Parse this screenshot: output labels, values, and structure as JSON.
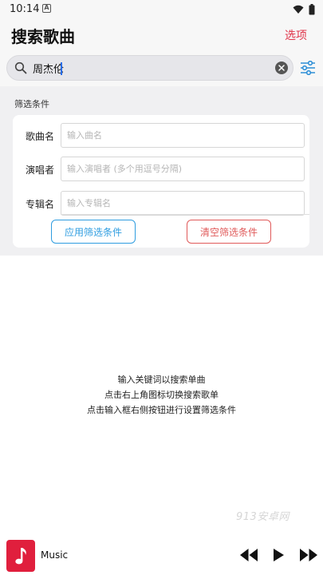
{
  "status": {
    "time": "10:14",
    "notif": "A"
  },
  "app_bar": {
    "title": "搜索歌曲",
    "options_label": "选项"
  },
  "search": {
    "value": "周杰伦"
  },
  "filter": {
    "title": "筛选条件",
    "fields": [
      {
        "label": "歌曲名",
        "placeholder": "输入曲名"
      },
      {
        "label": "演唱者",
        "placeholder": "输入演唱者 (多个用逗号分隔)"
      },
      {
        "label": "专辑名",
        "placeholder": "输入专辑名"
      }
    ],
    "apply_label": "应用筛选条件",
    "clear_label": "清空筛选条件"
  },
  "hints": [
    "输入关键词以搜索单曲",
    "点击右上角图标切换搜索歌单",
    "点击输入框右侧按钮进行设置筛选条件"
  ],
  "watermark": "913安卓网",
  "player": {
    "track_title": "Music",
    "icons": [
      "music-note-icon",
      "skip-previous-icon",
      "play-icon",
      "skip-next-icon"
    ]
  },
  "colors": {
    "accent_red": "#e0364a",
    "apply_blue": "#2f9de0",
    "clear_red": "#e05a5a",
    "album_red": "#e01f3d"
  }
}
